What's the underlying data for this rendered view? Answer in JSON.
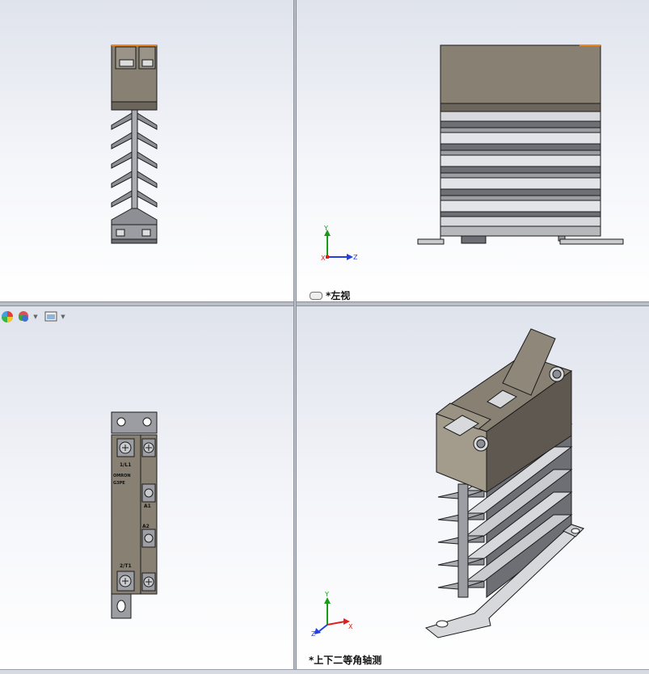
{
  "views": {
    "top_right_label": "*左视",
    "bottom_right_label": "*上下二等角轴测"
  },
  "triad": {
    "y": "Y",
    "x": "X",
    "z": "Z"
  },
  "icons": {
    "view_link": "link-icon",
    "appearance": "appearance-icon",
    "scene": "scene-icon",
    "display_settings": "display-settings-icon"
  },
  "part_markings": {
    "terminal_top": "1/L1",
    "brand": "OMRON",
    "model": "G3PE",
    "terminal_a1": "A1",
    "terminal_a2": "A2",
    "terminal_bottom": "2/T1"
  },
  "colors": {
    "body": "#878073",
    "body_dark": "#6c655b",
    "heatsink": "#c9cbcf",
    "heatsink_dark": "#6e6f74",
    "outline": "#1b1b1b",
    "accent_orange": "#f08a1c",
    "axis_red": "#e02020",
    "axis_green": "#1a9a1a",
    "axis_blue": "#2040e0"
  }
}
